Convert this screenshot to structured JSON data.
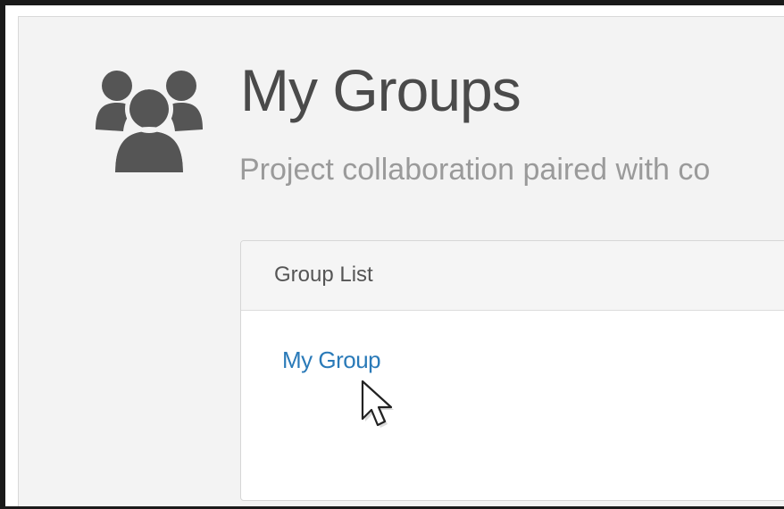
{
  "header": {
    "title": "My Groups",
    "subtitle": "Project collaboration paired with co",
    "icon": "groups-icon"
  },
  "group_list": {
    "heading": "Group List",
    "items": [
      {
        "label": "My Group"
      }
    ]
  },
  "pointer": {
    "icon": "mouse-cursor-icon"
  },
  "colors": {
    "page_bg": "#f3f3f3",
    "title": "#4a4a4a",
    "subtitle": "#9a9a9a",
    "link": "#2a7ab8",
    "icon": "#555555"
  }
}
